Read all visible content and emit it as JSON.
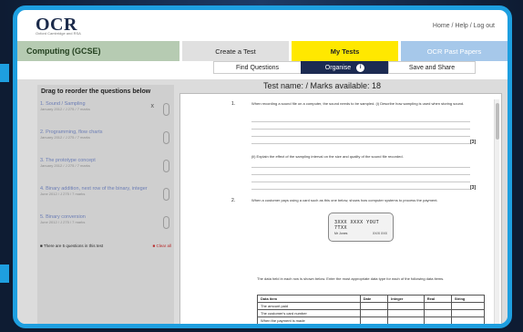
{
  "header": {
    "logo_text": "OCR",
    "logo_subtext": "Oxford Cambridge and RSA",
    "top_links": "Home / Help / Log out"
  },
  "nav": {
    "course": "Computing (GCSE)",
    "tabs": [
      "Create a Test",
      "My Tests",
      "OCR Past Papers"
    ],
    "active_tab": "My Tests"
  },
  "subnav": {
    "tabs": [
      "Find Questions",
      "Organise",
      "Save and Share"
    ],
    "active": "Organise",
    "info_glyph": "i"
  },
  "left_panel": {
    "title": "Drag to reorder the questions below",
    "items": [
      {
        "title": "1. Sound / Sampling",
        "meta": "January 2012 / J 275 / 7 marks",
        "remove": "x"
      },
      {
        "title": "2. Programming, flow charts",
        "meta": "January 2012 / J 275 / 7 marks"
      },
      {
        "title": "3. The prototype concept",
        "meta": "January 2012 / J 275 / 7 marks"
      },
      {
        "title": "4. Binary addition, next row of the binary, integer",
        "meta": "June 2012 / J 275 / 7 marks"
      },
      {
        "title": "5. Binary conversion",
        "meta": "June 2012 / J 275 / 7 marks"
      }
    ],
    "footer_check": "■ There are 5 questions in this test",
    "footer_clear": "■ Clear all"
  },
  "paper": {
    "title": "Test name: / Marks available: 18",
    "q1_num": "1.",
    "q1_text": "When recording a sound file on a computer, the sound needs to be sampled. (i) Describe how sampling is used when storing sound.",
    "q1_mark": "[3]",
    "q1b_text": "(ii) Explain the effect of the sampling interval on the size and quality of the sound file recorded.",
    "q1b_mark": "[3]",
    "q2_num": "2.",
    "q2_text": "When a customer pays using a card such as this one below, shows how computer systems to process the payment.",
    "lcd_line1": "3XXX XXXX YOUT 7TXX",
    "lcd_line2": "Mr Jones",
    "lcd_line3": "XX/X  XXX",
    "q2b_text": "The data held in each row is shown below. Enter the most appropriate data type for each of the following data items.",
    "table_headers": [
      "Data item",
      "Date",
      "Integer",
      "Real",
      "String"
    ],
    "table_rows": [
      [
        "The amount paid",
        "",
        "",
        "",
        ""
      ],
      [
        "The customer's card number",
        "",
        "",
        "",
        ""
      ],
      [
        "When the payment is made",
        "",
        "",
        "",
        ""
      ]
    ]
  },
  "colors": {
    "frame_border": "#1e9fe0",
    "active_tab": "#ffe800",
    "course_bar": "#b6cbb2",
    "organise_tab": "#1c2b52"
  }
}
